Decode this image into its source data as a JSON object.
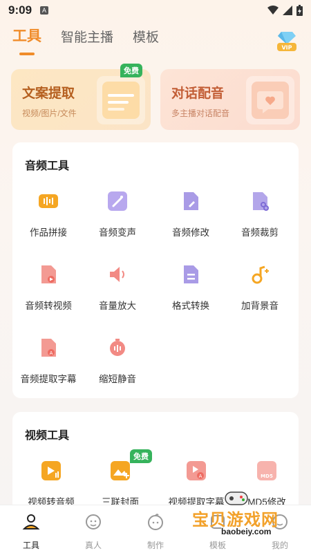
{
  "status": {
    "time": "9:09"
  },
  "tabs": [
    {
      "label": "工具"
    },
    {
      "label": "智能主播"
    },
    {
      "label": "模板"
    }
  ],
  "hero": [
    {
      "title": "文案提取",
      "subtitle": "视频/图片/文件",
      "badge": "免费"
    },
    {
      "title": "对话配音",
      "subtitle": "多主播对话配音"
    }
  ],
  "audio_tools": {
    "title": "音频工具",
    "items": [
      {
        "label": "作品拼接",
        "icon": "waveform-icon"
      },
      {
        "label": "音频变声",
        "icon": "magic-wand-icon"
      },
      {
        "label": "音频修改",
        "icon": "edit-file-icon"
      },
      {
        "label": "音频裁剪",
        "icon": "scissors-file-icon"
      },
      {
        "label": "音频转视频",
        "icon": "audio-to-video-icon"
      },
      {
        "label": "音量放大",
        "icon": "speaker-icon"
      },
      {
        "label": "格式转换",
        "icon": "format-file-icon"
      },
      {
        "label": "加背景音",
        "icon": "music-note-icon"
      },
      {
        "label": "音频提取字幕",
        "icon": "subtitle-file-icon"
      },
      {
        "label": "缩短静音",
        "icon": "timer-icon"
      }
    ]
  },
  "video_tools": {
    "title": "视频工具",
    "items": [
      {
        "label": "视频转音频",
        "icon": "video-to-audio-icon"
      },
      {
        "label": "三联封面",
        "icon": "cover-grid-icon",
        "badge": "免费"
      },
      {
        "label": "视频提取字幕",
        "icon": "video-subtitle-icon"
      },
      {
        "label": "MD5修改",
        "icon": "md5-icon"
      }
    ]
  },
  "bottom_nav": [
    {
      "label": "工具"
    },
    {
      "label": "真人"
    },
    {
      "label": "制作"
    },
    {
      "label": "模板"
    },
    {
      "label": "我的"
    }
  ],
  "watermark": {
    "text": "宝贝游戏网",
    "url": "baobeiy.com"
  },
  "colors": {
    "accent": "#f08c2a",
    "free_badge": "#36b35c"
  }
}
